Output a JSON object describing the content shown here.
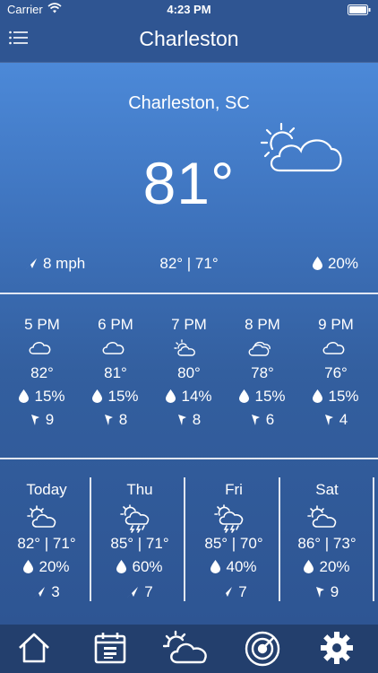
{
  "status_bar": {
    "carrier": "Carrier",
    "time": "4:23 PM"
  },
  "nav": {
    "title": "Charleston",
    "menu_icon": "hamburger-menu-icon"
  },
  "current": {
    "location": "Charleston, SC",
    "temperature": "81°",
    "condition_icon": "partly-cloudy-icon",
    "wind": "8 mph",
    "hi_lo": "82° | 71°",
    "precip": "20%"
  },
  "hourly": [
    {
      "time": "5 PM",
      "icon": "cloud-icon",
      "temp": "82°",
      "rain": "15%",
      "wind": "9"
    },
    {
      "time": "6 PM",
      "icon": "cloud-icon",
      "temp": "81°",
      "rain": "15%",
      "wind": "8"
    },
    {
      "time": "7 PM",
      "icon": "partly-cloudy-icon",
      "temp": "80°",
      "rain": "14%",
      "wind": "8"
    },
    {
      "time": "8 PM",
      "icon": "cloudy-icon",
      "temp": "78°",
      "rain": "15%",
      "wind": "6"
    },
    {
      "time": "9 PM",
      "icon": "cloud-icon",
      "temp": "76°",
      "rain": "15%",
      "wind": "4"
    }
  ],
  "daily": [
    {
      "day": "Today",
      "icon": "partly-cloudy-icon",
      "hi_lo": "82° | 71°",
      "rain": "20%",
      "wind": "3"
    },
    {
      "day": "Thu",
      "icon": "thunderstorm-icon",
      "hi_lo": "85° | 71°",
      "rain": "60%",
      "wind": "7"
    },
    {
      "day": "Fri",
      "icon": "thunderstorm-icon",
      "hi_lo": "85° | 70°",
      "rain": "40%",
      "wind": "7"
    },
    {
      "day": "Sat",
      "icon": "partly-cloudy-icon",
      "hi_lo": "86° | 73°",
      "rain": "20%",
      "wind": "9"
    }
  ],
  "tabbar": {
    "items": [
      "home-icon",
      "calendar-icon",
      "weather-icon",
      "radar-icon",
      "settings-icon"
    ]
  }
}
